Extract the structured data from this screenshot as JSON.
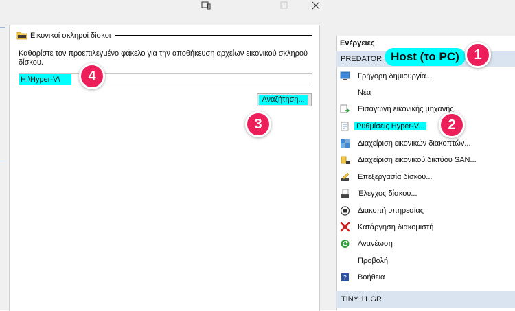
{
  "dialog": {
    "group_title": "Εικονικοί σκληροί δίσκοι",
    "instruction": "Καθορίστε τον προεπιλεγμένο φάκελο για την αποθήκευση αρχείων εικονικού σκληρού δίσκου.",
    "path_value": "H:\\Hyper-V\\",
    "browse_label": "Αναζήτηση..."
  },
  "actions": {
    "header": "Ενέργειες",
    "server": "PREDATOR",
    "host_callout": "Host (το PC)",
    "items": [
      {
        "label": "Γρήγορη δημιουργία...",
        "icon": "quick-create-icon"
      },
      {
        "label": "Νέα",
        "icon": ""
      },
      {
        "label": "Εισαγωγή εικονικής μηχανής...",
        "icon": "import-vm-icon"
      },
      {
        "label": "Ρυθμίσεις Hyper-V...",
        "icon": "settings-icon"
      },
      {
        "label": "Διαχείριση εικονικών διακοπτών...",
        "icon": "switch-manager-icon"
      },
      {
        "label": "Διαχείριση εικονικού δικτύου SAN...",
        "icon": "san-manager-icon"
      },
      {
        "label": "Επεξεργασία δίσκου...",
        "icon": "edit-disk-icon"
      },
      {
        "label": "Έλεγχος δίσκου...",
        "icon": "inspect-disk-icon"
      },
      {
        "label": "Διακοπή υπηρεσίας",
        "icon": "stop-service-icon"
      },
      {
        "label": "Κατάργηση διακομιστή",
        "icon": "remove-server-icon"
      },
      {
        "label": "Ανανέωση",
        "icon": "refresh-icon"
      },
      {
        "label": "Προβολή",
        "icon": ""
      },
      {
        "label": "Βοήθεια",
        "icon": "help-icon"
      }
    ],
    "second_server": "TINY 11 GR"
  },
  "badges": [
    "1",
    "2",
    "3",
    "4"
  ],
  "colors": {
    "highlight": "#00ffff",
    "badge": "#ec1f5a",
    "server_row": "#d9e4f0"
  }
}
